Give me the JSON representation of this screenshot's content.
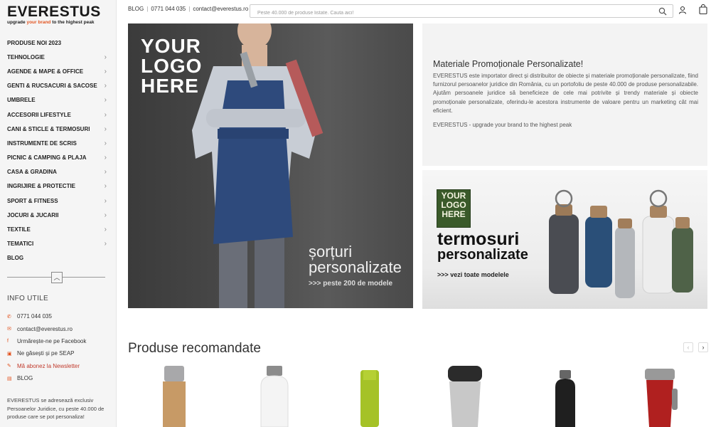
{
  "brand": {
    "name": "EVERESTUS",
    "tagline_pre": "upgrade ",
    "tagline_accent": "your brand",
    "tagline_post": " to the highest peak"
  },
  "header": {
    "blog": "BLOG",
    "phone": "0771 044 035",
    "email": "contact@everestus.ro",
    "search_placeholder": "Peste 40.000 de produse listate. Cauta aici!"
  },
  "sidebar": {
    "items": [
      {
        "label": "PRODUSE NOI 2023",
        "chevron": false
      },
      {
        "label": "TEHNOLOGIE",
        "chevron": true
      },
      {
        "label": "AGENDE & MAPE & OFFICE",
        "chevron": true
      },
      {
        "label": "GENTI & RUCSACURI & SACOSE",
        "chevron": true
      },
      {
        "label": "UMBRELE",
        "chevron": true
      },
      {
        "label": "ACCESORII LIFESTYLE",
        "chevron": true
      },
      {
        "label": "CANI & STICLE & TERMOSURI",
        "chevron": true
      },
      {
        "label": "INSTRUMENTE DE SCRIS",
        "chevron": true
      },
      {
        "label": "PICNIC & CAMPING & PLAJA",
        "chevron": true
      },
      {
        "label": "CASA & GRADINA",
        "chevron": true
      },
      {
        "label": "INGRIJIRE & PROTECTIE",
        "chevron": true
      },
      {
        "label": "SPORT & FITNESS",
        "chevron": true
      },
      {
        "label": "JOCURI & JUCARII",
        "chevron": true
      },
      {
        "label": "TEXTILE",
        "chevron": true
      },
      {
        "label": "TEMATICI",
        "chevron": true
      },
      {
        "label": "BLOG",
        "chevron": false
      }
    ],
    "info_title": "INFO UTILE",
    "info_items": [
      {
        "icon": "phone-icon",
        "label": "0771 044 035"
      },
      {
        "icon": "mail-icon",
        "label": "contact@everestus.ro"
      },
      {
        "icon": "facebook-icon",
        "label": "Urmărește-ne pe Facebook"
      },
      {
        "icon": "seap-icon",
        "label": "Ne găsești și pe SEAP"
      },
      {
        "icon": "newsletter-icon",
        "label": "Mă abonez la Newsletter"
      },
      {
        "icon": "blog-icon",
        "label": "BLOG"
      }
    ],
    "info_text": "EVERESTUS se adresează exclusiv Persoanelor Juridice, cu peste 40.000 de produse care se pot personaliza!"
  },
  "hero_left": {
    "logo_line1": "YOUR",
    "logo_line2": "LOGO",
    "logo_line3": "HERE",
    "title_line1": "șorțuri",
    "title_line2": "personalizate",
    "subtitle": ">>> peste 200 de modele"
  },
  "hero_right_top": {
    "title": "Materiale Promoționale Personalizate!",
    "description": "EVERESTUS este importator direct și distribuitor de obiecte și materiale promoționale personalizate, fiind furnizorul persoanelor juridice din România, cu un portofoliu de peste 40.000 de produse personalizabile. Ajutăm persoanele juridice să beneficieze de cele mai potrivite și trendy materiale și obiecte promoționale personalizate, oferindu-le acestora instrumente de valoare pentru un marketing cât mai eficient.",
    "tagline": "EVERESTUS - upgrade your brand to the highest peak"
  },
  "hero_right_bottom": {
    "logo_line1": "YOUR",
    "logo_line2": "LOGO",
    "logo_line3": "HERE",
    "title_line1": "termosuri",
    "title_line2": "personalizate",
    "subtitle": ">>> vezi toate modelele"
  },
  "recommended": {
    "title": "Produse recomandate",
    "prev": "‹",
    "next": "›"
  },
  "colors": {
    "accent": "#e2531f",
    "sidebar_bg": "#f5f5f5"
  }
}
